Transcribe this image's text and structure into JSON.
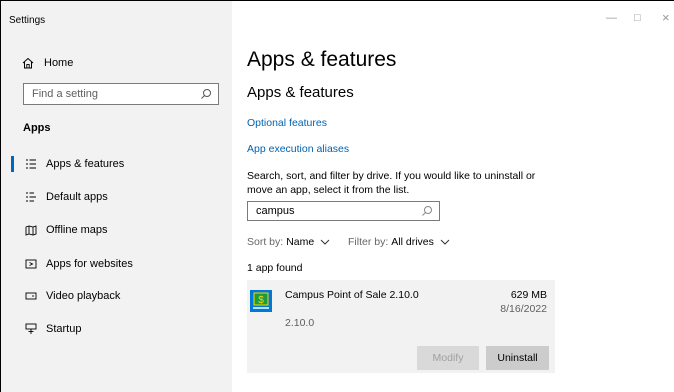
{
  "window": {
    "title": "Settings",
    "controls": {
      "minimize": "—",
      "maximize": "□",
      "close": "×"
    }
  },
  "sidebar": {
    "home_label": "Home",
    "search_placeholder": "Find a setting",
    "section_title": "Apps",
    "items": [
      {
        "label": "Apps & features",
        "icon": "apps-features-icon",
        "active": true
      },
      {
        "label": "Default apps",
        "icon": "default-apps-icon",
        "active": false
      },
      {
        "label": "Offline maps",
        "icon": "offline-maps-icon",
        "active": false
      },
      {
        "label": "Apps for websites",
        "icon": "apps-websites-icon",
        "active": false
      },
      {
        "label": "Video playback",
        "icon": "video-playback-icon",
        "active": false
      },
      {
        "label": "Startup",
        "icon": "startup-icon",
        "active": false
      }
    ]
  },
  "main": {
    "page_title": "Apps & features",
    "section_title": "Apps & features",
    "links": [
      "Optional features",
      "App execution aliases"
    ],
    "description": "Search, sort, and filter by drive. If you would like to uninstall or move an app, select it from the list.",
    "search_value": "campus",
    "sort": {
      "label": "Sort by:",
      "value": "Name"
    },
    "filter": {
      "label": "Filter by:",
      "value": "All drives"
    },
    "result_count": "1 app found",
    "apps": [
      {
        "name": "Campus Point of Sale 2.10.0",
        "size": "629 MB",
        "date": "8/16/2022",
        "version": "2.10.0",
        "modify_label": "Modify",
        "uninstall_label": "Uninstall"
      }
    ]
  },
  "colors": {
    "accent": "#0067c0",
    "link": "#0063b1",
    "sidebar_bg": "#f2f2f2"
  }
}
